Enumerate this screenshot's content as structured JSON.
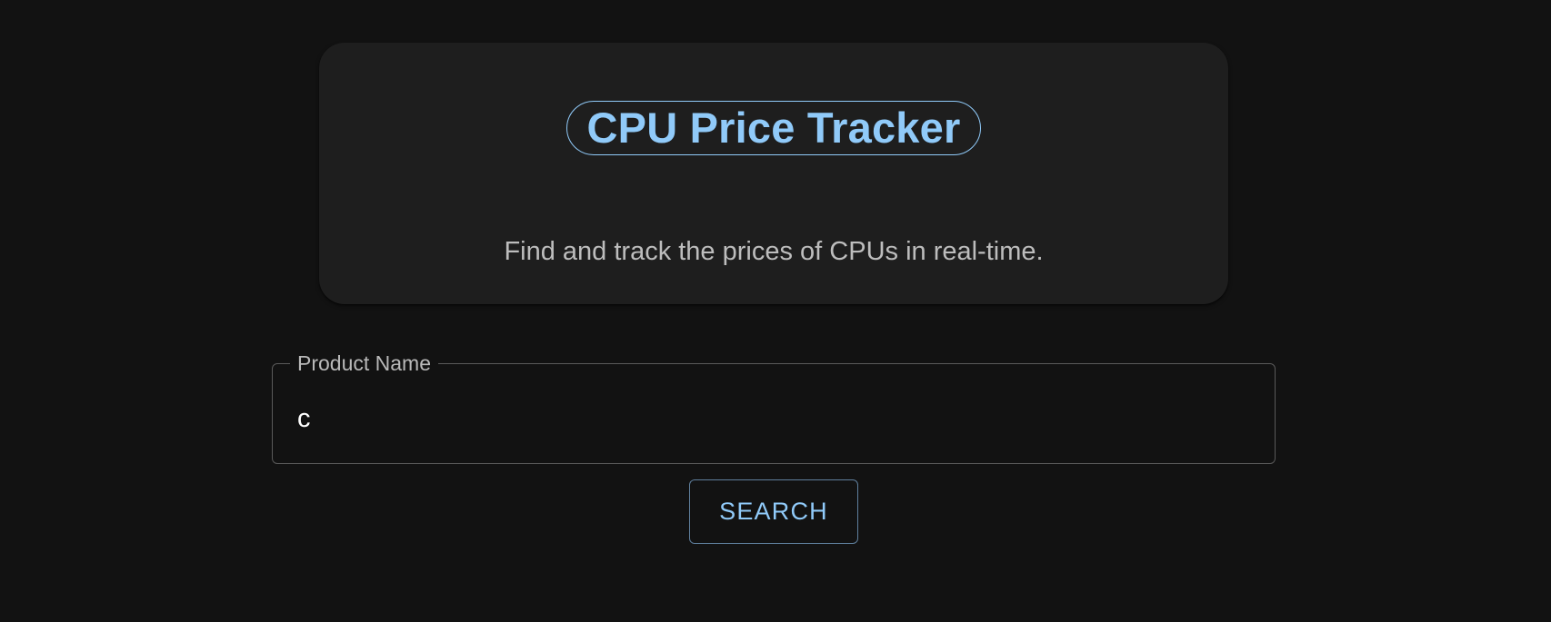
{
  "header": {
    "title": "CPU Price Tracker",
    "subtitle": "Find and track the prices of CPUs in real-time."
  },
  "search": {
    "label": "Product Name",
    "value": "c",
    "button_label": "SEARCH"
  },
  "colors": {
    "background": "#121212",
    "card": "#1e1e1e",
    "accent": "#90caf9",
    "text_secondary": "#bdbdbd"
  }
}
